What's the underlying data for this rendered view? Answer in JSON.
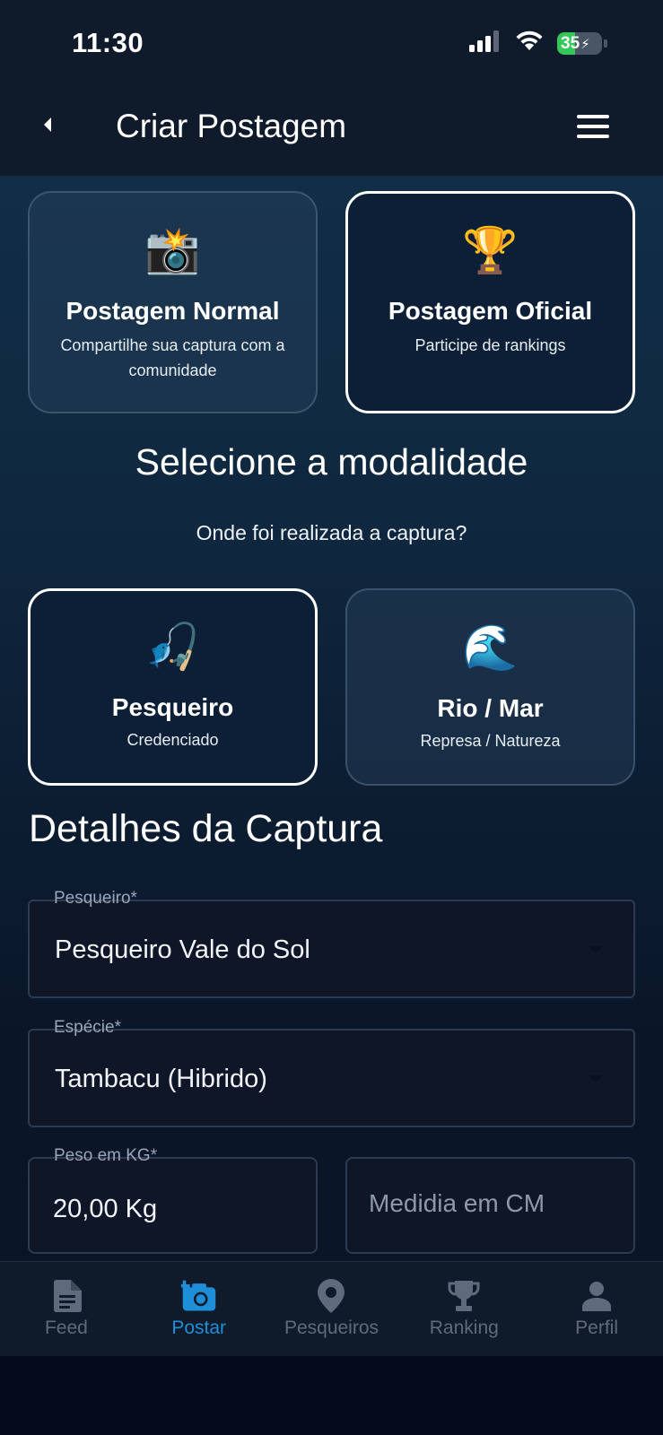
{
  "status_bar": {
    "time": "11:30",
    "battery": "35",
    "icons": [
      "signal-icon",
      "wifi-icon",
      "battery-icon"
    ]
  },
  "header": {
    "title": "Criar Postagem",
    "back_icon": "chevron-left-icon",
    "menu_icon": "hamburger-menu-icon"
  },
  "post_types": [
    {
      "emoji": "📸",
      "title": "Postagem Normal",
      "subtitle": "Compartilhe sua captura com a comunidade",
      "selected": false
    },
    {
      "emoji": "🏆",
      "title": "Postagem Oficial",
      "subtitle": "Participe de rankings",
      "selected": true
    }
  ],
  "modality": {
    "title": "Selecione a modalidade",
    "question": "Onde foi realizada a captura?",
    "options": [
      {
        "emoji": "🎣",
        "title": "Pesqueiro",
        "subtitle": "Credenciado",
        "selected": true
      },
      {
        "emoji": "🌊",
        "title": "Rio / Mar",
        "subtitle": "Represa / Natureza",
        "selected": false
      }
    ]
  },
  "details": {
    "title": "Detalhes da Captura",
    "pesqueiro": {
      "label": "Pesqueiro*",
      "value": "Pesqueiro Vale do Sol"
    },
    "especie": {
      "label": "Espécie*",
      "value": "Tambacu (Hibrido)"
    },
    "peso": {
      "label": "Peso em KG*",
      "value": "20,00 Kg"
    },
    "medida": {
      "placeholder": "Medidia em CM"
    }
  },
  "bottom_nav": [
    {
      "label": "Feed",
      "icon": "document-icon",
      "active": false
    },
    {
      "label": "Postar",
      "icon": "add-camera-icon",
      "active": true
    },
    {
      "label": "Pesqueiros",
      "icon": "location-pin-icon",
      "active": false
    },
    {
      "label": "Ranking",
      "icon": "trophy-icon",
      "active": false
    },
    {
      "label": "Perfil",
      "icon": "person-icon",
      "active": false
    }
  ],
  "colors": {
    "accent": "#1d8fd9",
    "inactive_nav": "#5f6b7c",
    "header_bg": "#0f1a2b",
    "battery_green": "#34c759"
  }
}
